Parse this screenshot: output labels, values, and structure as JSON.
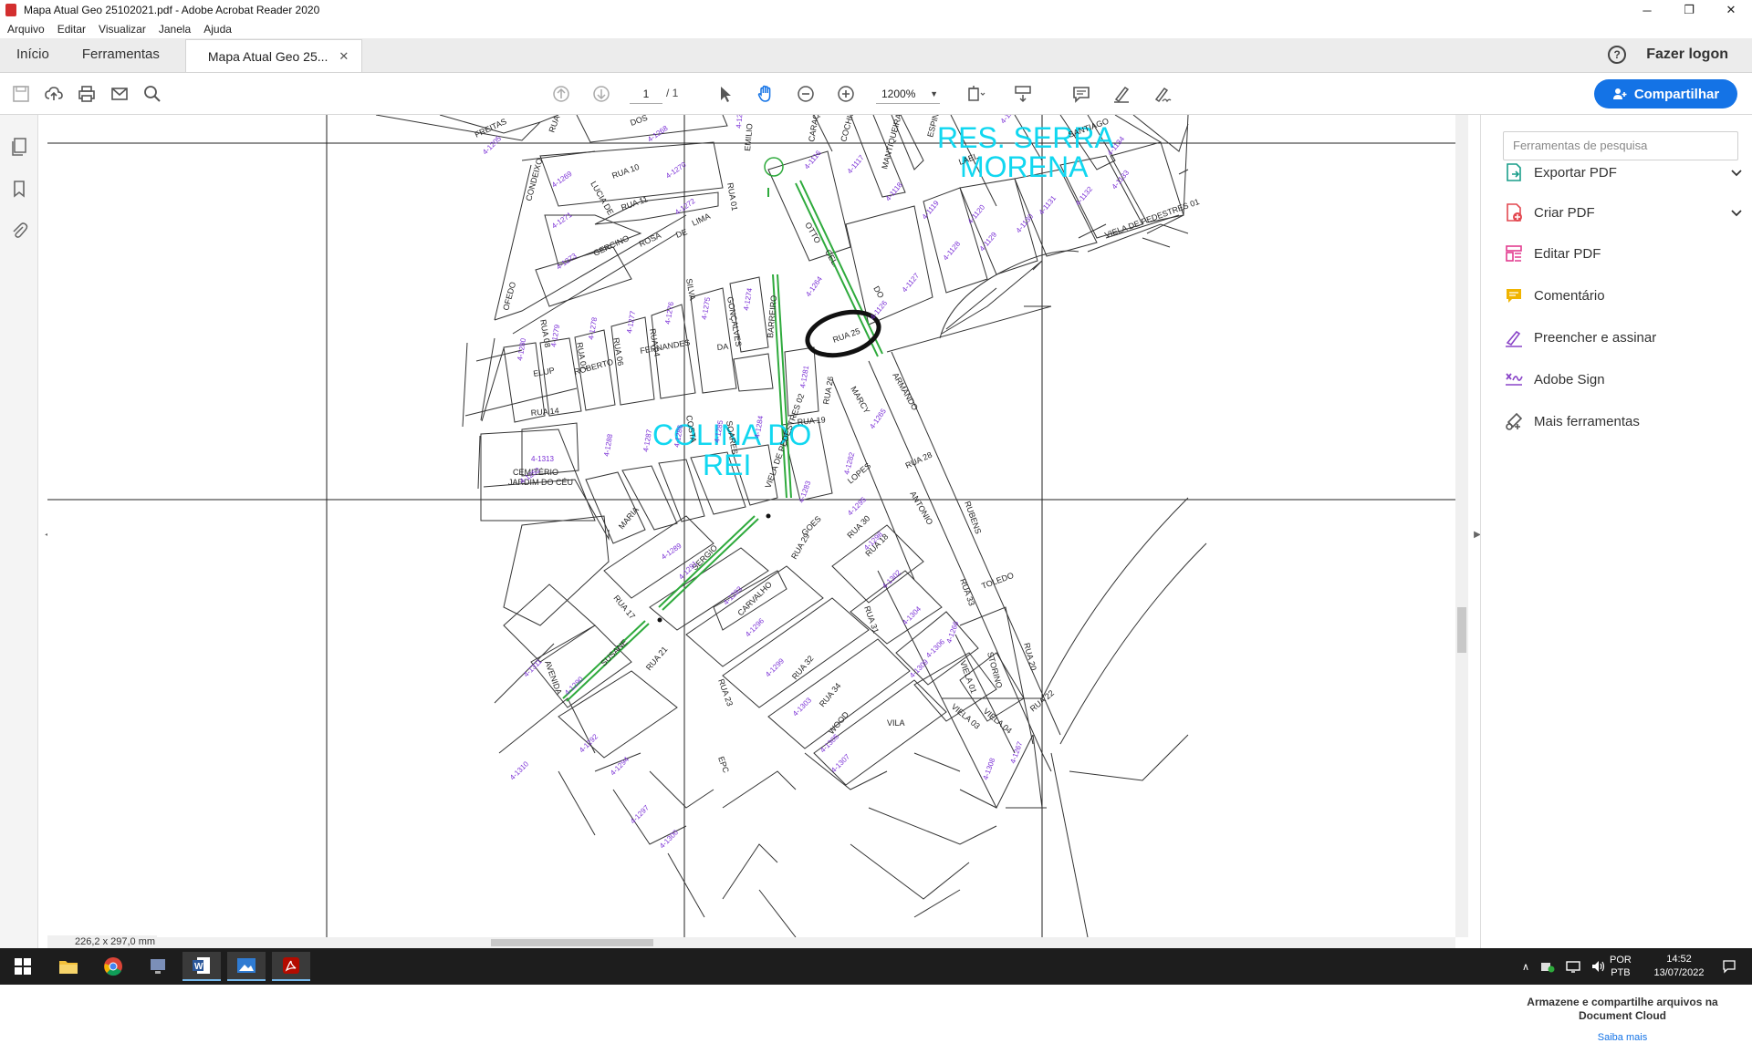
{
  "window": {
    "title": "Mapa Atual Geo 25102021.pdf - Adobe Acrobat Reader 2020",
    "minimize": "─",
    "restore": "❐",
    "close": "✕"
  },
  "menu": [
    "Arquivo",
    "Editar",
    "Visualizar",
    "Janela",
    "Ajuda"
  ],
  "tabs": {
    "home": "Início",
    "tools": "Ferramentas",
    "document": "Mapa Atual Geo 25...",
    "document_close": "✕",
    "help": "?",
    "login": "Fazer logon"
  },
  "toolbar": {
    "page_current": "1",
    "page_total": "/ 1",
    "zoom": "1200%",
    "share_label": "Compartilhar"
  },
  "document": {
    "page_size": "226,2 x 297,0 mm",
    "neighborhoods": {
      "serra_line1": "RES. SERRA",
      "serra_line2": "MORENA",
      "colina_line1": "COLINA DO",
      "colina_line2": "REI"
    },
    "map_labels": [
      {
        "t": "FREITAS"
      },
      {
        "t": "RUA"
      },
      {
        "t": "DOS"
      },
      {
        "t": "EMILIO"
      },
      {
        "t": "CARAÇA"
      },
      {
        "t": "COCHIS"
      },
      {
        "t": "MANTIQUEIRA"
      },
      {
        "t": "ESPINHAÇO"
      },
      {
        "t": "SANTIAGO"
      },
      {
        "t": "RUA 10"
      },
      {
        "t": "RUA 11"
      },
      {
        "t": "CONDEIXO"
      },
      {
        "t": "LUCIA DE"
      },
      {
        "t": "RUA 01"
      },
      {
        "t": "GERCINO"
      },
      {
        "t": "ROSA"
      },
      {
        "t": "DE"
      },
      {
        "t": "LIMA"
      },
      {
        "t": "SILVA"
      },
      {
        "t": "GONÇALVES"
      },
      {
        "t": "OTTO"
      },
      {
        "t": "CEL."
      },
      {
        "t": "DO"
      },
      {
        "t": "LAEL"
      },
      {
        "t": "OFEDO"
      },
      {
        "t": "RUA 08"
      },
      {
        "t": "RUA 07"
      },
      {
        "t": "RUA 06"
      },
      {
        "t": "RUA 04"
      },
      {
        "t": "ROBERTO"
      },
      {
        "t": "FERNANDES"
      },
      {
        "t": "DA"
      },
      {
        "t": "BARREIRO"
      },
      {
        "t": "RUA 25"
      },
      {
        "t": "MARCY"
      },
      {
        "t": "ARMANDO"
      },
      {
        "t": "ELUP"
      },
      {
        "t": "RUA 14"
      },
      {
        "t": "RUA 19"
      },
      {
        "t": "RUA 26"
      },
      {
        "t": "RUA 28"
      },
      {
        "t": "CEMITÉRIO"
      },
      {
        "t": "JARDIM DO CÉU"
      },
      {
        "t": "COSTA"
      },
      {
        "t": "SOARES"
      },
      {
        "t": "LOPES"
      },
      {
        "t": "ANTONIO"
      },
      {
        "t": "RUBENS"
      },
      {
        "t": "MARIA"
      },
      {
        "t": "SERGIO"
      },
      {
        "t": "CARVALHO"
      },
      {
        "t": "GOES"
      },
      {
        "t": "RUA 29"
      },
      {
        "t": "RUA 30"
      },
      {
        "t": "RUA 18"
      },
      {
        "t": "RUA 17"
      },
      {
        "t": "AVENIDA"
      },
      {
        "t": "SUSANE"
      },
      {
        "t": "RUA 21"
      },
      {
        "t": "RUA 31"
      },
      {
        "t": "RUA 32"
      },
      {
        "t": "RUA 34"
      },
      {
        "t": "WOOD"
      },
      {
        "t": "RUA 33"
      },
      {
        "t": "TOLEDO"
      },
      {
        "t": "STORINO"
      },
      {
        "t": "RUA 20"
      },
      {
        "t": "VIELA 01"
      },
      {
        "t": "VIELA 03"
      },
      {
        "t": "VIELA 04"
      },
      {
        "t": "RUA 22"
      },
      {
        "t": "RUA 23"
      },
      {
        "t": "EPC"
      },
      {
        "t": "VILA"
      },
      {
        "t": "VIELA DE PEDESTRES 02"
      },
      {
        "t": "VIELA DE PEDESTRES 01"
      }
    ],
    "lot_labels": [
      {
        "t": "4-1205"
      },
      {
        "t": "4-1268"
      },
      {
        "t": "4-1269"
      },
      {
        "t": "4-1270"
      },
      {
        "t": "4-1271"
      },
      {
        "t": "4-1272"
      },
      {
        "t": "4-1273"
      },
      {
        "t": "4-1263"
      },
      {
        "t": "4-1116"
      },
      {
        "t": "4-1117"
      },
      {
        "t": "4-1118"
      },
      {
        "t": "4-1119"
      },
      {
        "t": "4-1120"
      },
      {
        "t": "4-1122"
      },
      {
        "t": "4-1134"
      },
      {
        "t": "4-1133"
      },
      {
        "t": "4-1132"
      },
      {
        "t": "4-1131"
      },
      {
        "t": "4-1130"
      },
      {
        "t": "4-1129"
      },
      {
        "t": "4-1128"
      },
      {
        "t": "4-1127"
      },
      {
        "t": "4-1126"
      },
      {
        "t": "4-1264"
      },
      {
        "t": "4-1274"
      },
      {
        "t": "4-1275"
      },
      {
        "t": "4-1276"
      },
      {
        "t": "4-1277"
      },
      {
        "t": "4-1278"
      },
      {
        "t": "4-1279"
      },
      {
        "t": "4-1280"
      },
      {
        "t": "4-1313"
      },
      {
        "t": "4-1281"
      },
      {
        "t": "4-1265"
      },
      {
        "t": "4-1284"
      },
      {
        "t": "4-1285"
      },
      {
        "t": "4-1286"
      },
      {
        "t": "4-1287"
      },
      {
        "t": "4-1288"
      },
      {
        "t": "4-1252"
      },
      {
        "t": "4-1282"
      },
      {
        "t": "4-1283"
      },
      {
        "t": "4-1289"
      },
      {
        "t": "4-1291"
      },
      {
        "t": "4-1293"
      },
      {
        "t": "4-1295"
      },
      {
        "t": "4-1296"
      },
      {
        "t": "4-1298"
      },
      {
        "t": "4-1299"
      },
      {
        "t": "4-1302"
      },
      {
        "t": "4-1303"
      },
      {
        "t": "4-1304"
      },
      {
        "t": "4-1305"
      },
      {
        "t": "4-1306"
      },
      {
        "t": "4-1307"
      },
      {
        "t": "4-1309"
      },
      {
        "t": "4-1311"
      },
      {
        "t": "4-1290"
      },
      {
        "t": "4-1292"
      },
      {
        "t": "4-1294"
      },
      {
        "t": "4-1297"
      },
      {
        "t": "4-1300"
      },
      {
        "t": "4-1310"
      },
      {
        "t": "4-1266"
      },
      {
        "t": "4-1308"
      },
      {
        "t": "4-1267"
      }
    ]
  },
  "right_panel": {
    "search_placeholder": "Ferramentas de pesquisa",
    "tools": [
      {
        "label": "Exportar PDF",
        "icon": "export-pdf-icon",
        "color": "#1a9e8a",
        "expandable": true
      },
      {
        "label": "Criar PDF",
        "icon": "create-pdf-icon",
        "color": "#e34850",
        "expandable": true
      },
      {
        "label": "Editar PDF",
        "icon": "edit-pdf-icon",
        "color": "#e23c8f",
        "expandable": false
      },
      {
        "label": "Comentário",
        "icon": "comment-icon",
        "color": "#f0b400",
        "expandable": false
      },
      {
        "label": "Preencher e assinar",
        "icon": "fill-sign-icon",
        "color": "#8a45c8",
        "expandable": false
      },
      {
        "label": "Adobe Sign",
        "icon": "adobe-sign-icon",
        "color": "#8a45c8",
        "expandable": false
      },
      {
        "label": "Mais ferramentas",
        "icon": "more-tools-icon",
        "color": "#555555",
        "expandable": false
      }
    ],
    "cloud_info": "Armazene e compartilhe arquivos na Document Cloud",
    "cloud_link": "Saiba mais"
  },
  "taskbar": {
    "lang_top": "POR",
    "lang_bottom": "PTB",
    "time": "14:52",
    "date": "13/07/2022"
  },
  "colors": {
    "accent": "#1473e6",
    "neighborhood_label": "#11d7f0",
    "lot_label": "#7a2fd6",
    "green_path": "#2eaa3c"
  }
}
